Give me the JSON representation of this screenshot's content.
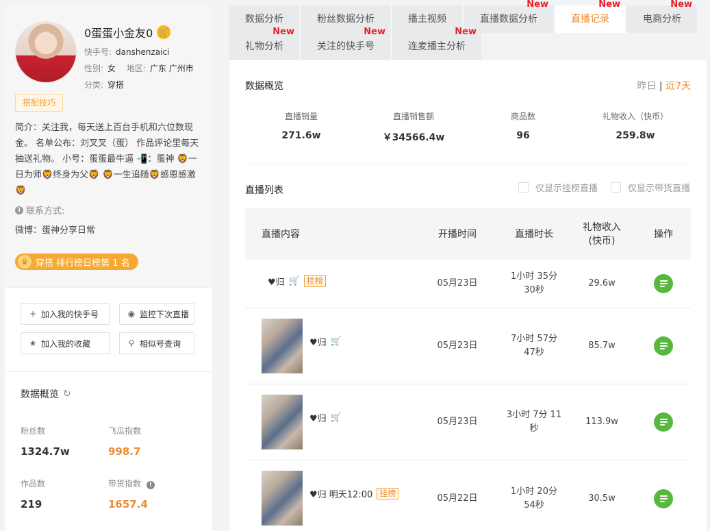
{
  "profile": {
    "name": "0蛋蛋小金友0",
    "kuaishou_label": "快手号:",
    "kuaishou_id": "danshenzaici",
    "gender_label": "性别:",
    "gender": "女",
    "region_label": "地区:",
    "region": "广东 广州市",
    "category_label": "分类:",
    "category": "穿搭",
    "tag": "搭配技巧",
    "bio": "简介：关注我，每天送上百台手机和六位数现金。 名单公布：刘叉叉（蛋） 作品评论里每天抽送礼物。 小号：蛋蛋最牛逼 📲：蛋神 🦁一日为师🦁终身为父🦁 🦁一生追随🦁感恩感激🦁",
    "contact_label": "联系方式:",
    "weibo": "微博：蛋神分享日常",
    "rank": "穿搭 排行榜日榜第 1 名"
  },
  "actions": {
    "add_kuaishou": "加入我的快手号",
    "monitor_live": "监控下次直播",
    "add_favorite": "加入我的收藏",
    "similar": "相似号查询"
  },
  "left_overview": {
    "title": "数据概览",
    "fans_label": "粉丝数",
    "fans": "1324.7w",
    "feigua_label": "飞瓜指数",
    "feigua": "998.7",
    "works_label": "作品数",
    "works": "219",
    "sales_index_label": "带货指数",
    "sales_index": "1657.4"
  },
  "tabs": {
    "row1": [
      {
        "label": "数据分析",
        "new": ""
      },
      {
        "label": "粉丝数据分析",
        "new": ""
      },
      {
        "label": "播主视频",
        "new": ""
      },
      {
        "label": "直播数据分析",
        "new": "New"
      },
      {
        "label": "直播记录",
        "new": "New"
      },
      {
        "label": "电商分析",
        "new": "New"
      }
    ],
    "row2": [
      {
        "label": "礼物分析",
        "new": "New"
      },
      {
        "label": "关注的快手号",
        "new": "New"
      },
      {
        "label": "连麦播主分析",
        "new": "New"
      }
    ]
  },
  "overview": {
    "title": "数据概览",
    "yesterday": "昨日",
    "sep": "|",
    "last7": "近7天",
    "items": [
      {
        "label": "直播销量",
        "value": "271.6w"
      },
      {
        "label": "直播销售额",
        "value": "￥34566.4w"
      },
      {
        "label": "商品数",
        "value": "96"
      },
      {
        "label": "礼物收入（快币）",
        "value": "259.8w"
      }
    ]
  },
  "list": {
    "title": "直播列表",
    "filter1": "仅显示挂榜直播",
    "filter2": "仅显示带货直播",
    "headers": {
      "content": "直播内容",
      "start": "开播时间",
      "duration": "直播时长",
      "gift": "礼物收入\n(快币)",
      "op": "操作"
    },
    "rows": [
      {
        "title": "♥归",
        "hang": "挂榜",
        "date": "05月23日",
        "duration": "1小时 35分\n30秒",
        "gift": "29.6w"
      },
      {
        "title": "♥归",
        "hang": "",
        "date": "05月23日",
        "duration": "7小时 57分\n47秒",
        "gift": "85.7w"
      },
      {
        "title": "♥归",
        "hang": "",
        "date": "05月23日",
        "duration": "3小时 7分 11\n秒",
        "gift": "113.9w"
      },
      {
        "title": "♥归 明天12:00",
        "hang": "挂榜",
        "date": "05月22日",
        "duration": "1小时 20分\n54秒",
        "gift": "30.5w"
      }
    ]
  }
}
